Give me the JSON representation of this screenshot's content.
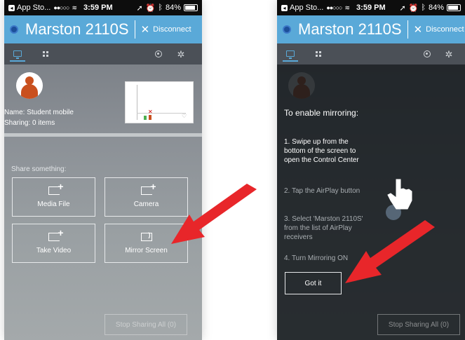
{
  "status_bar": {
    "back_label": "App Sto...",
    "signal": "●●○○○",
    "time": "3:59 PM",
    "battery": "84%"
  },
  "title_bar": {
    "room_name": "Marston 2110S",
    "disconnect_label": "Disconnect"
  },
  "user": {
    "name_label": "Name:",
    "name_value": "Student mobile",
    "sharing_label": "Sharing:",
    "sharing_count": "0",
    "sharing_unit": "items"
  },
  "share": {
    "title": "Share something:",
    "tiles": [
      {
        "label": "Media File"
      },
      {
        "label": "Camera"
      },
      {
        "label": "Take Video"
      },
      {
        "label": "Mirror Screen"
      }
    ],
    "stop_label": "Stop Sharing All (0)"
  },
  "mirroring_help": {
    "heading": "To enable mirroring:",
    "steps": [
      "1. Swipe up from the bottom of the screen to open the Control Center",
      "2. Tap the AirPlay button",
      "3. Select 'Marston 2110S' from the list of AirPlay receivers",
      "4. Turn Mirroring ON"
    ],
    "got_it_label": "Got it"
  },
  "colors": {
    "accent": "#5aa9d8",
    "arrow": "#e8262a",
    "avatar": "#c9501e"
  },
  "icons": [
    "monitor-icon",
    "grid-icon",
    "globe-icon",
    "gear-icon",
    "close-icon",
    "add-media-icon",
    "airplay-icon",
    "hand-pointer-icon"
  ]
}
